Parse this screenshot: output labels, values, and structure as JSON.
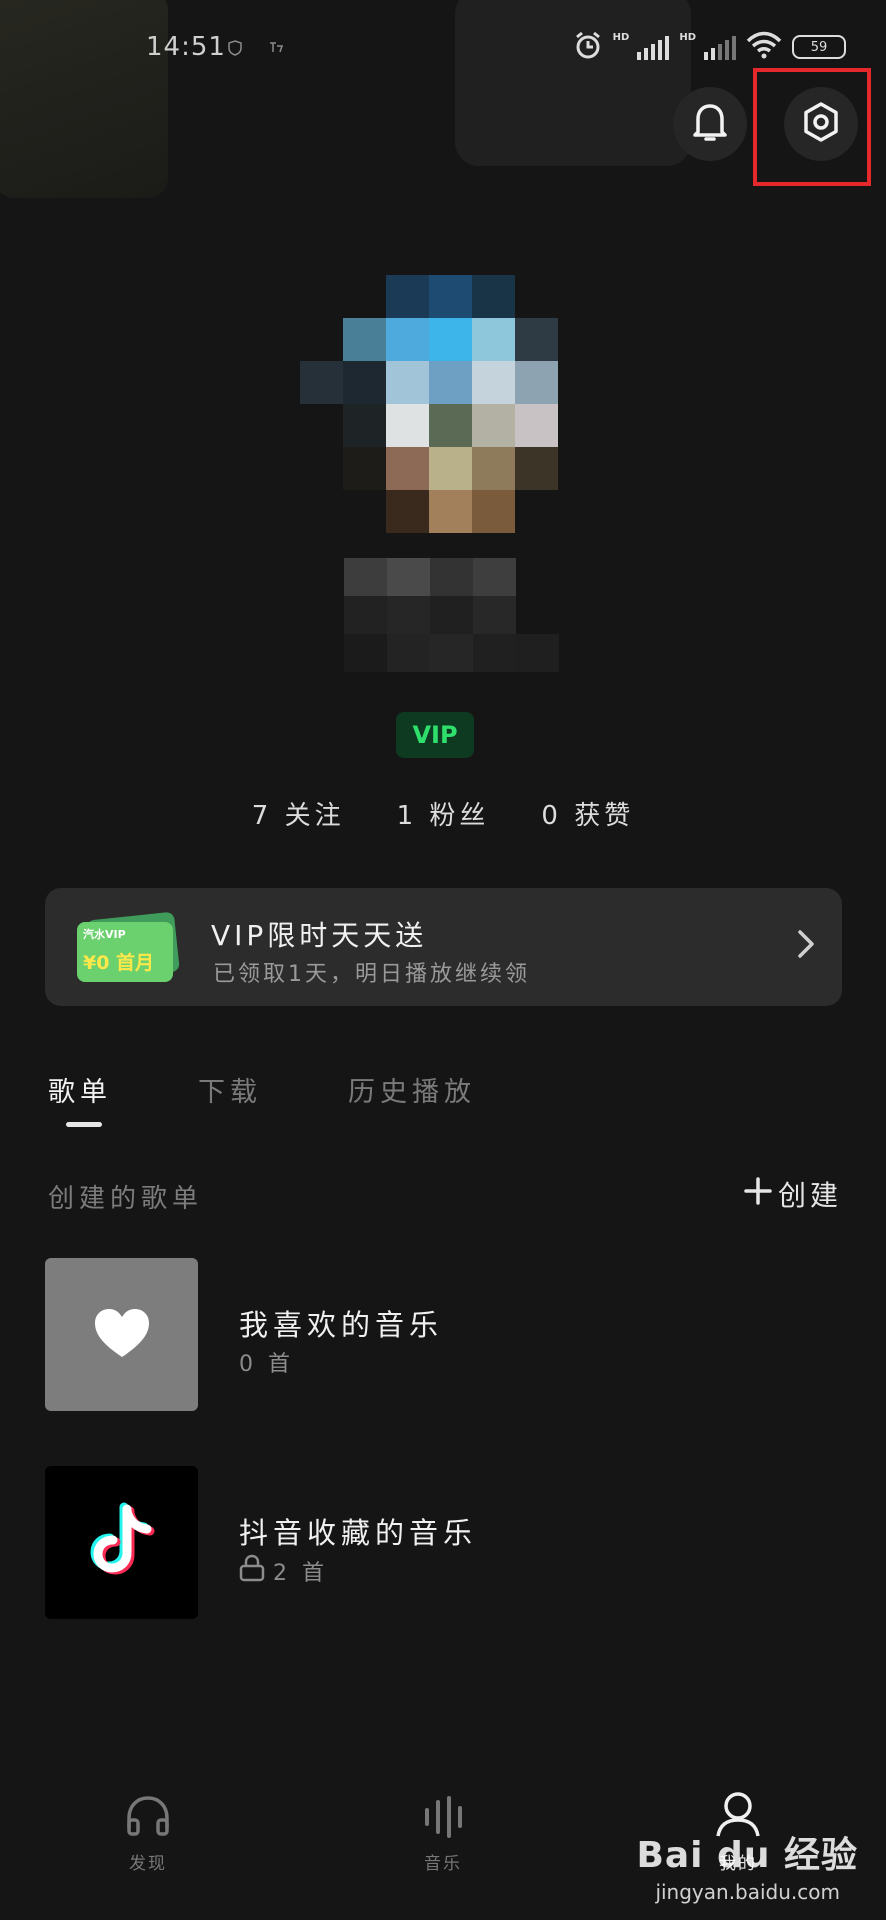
{
  "status_bar": {
    "time": "14:51",
    "battery": "59",
    "hd1": "HD",
    "hd2": "HD"
  },
  "profile": {
    "vip_badge": "VIP"
  },
  "stats": [
    {
      "label": "7 关注"
    },
    {
      "label": "1 粉丝"
    },
    {
      "label": "0 获赞"
    }
  ],
  "promo": {
    "ticket_brand": "汽水VIP",
    "ticket_offer": "¥0 首月",
    "title": "VIP限时天天送",
    "subtitle": "已领取1天，明日播放继续领"
  },
  "tabs": [
    {
      "label": "歌单",
      "active": true
    },
    {
      "label": "下载",
      "active": false
    },
    {
      "label": "历史播放",
      "active": false
    }
  ],
  "section": {
    "title": "创建的歌单",
    "create_label": "创建"
  },
  "playlists": [
    {
      "title": "我喜欢的音乐",
      "count": "0 首"
    },
    {
      "title": "抖音收藏的音乐",
      "count": "2 首"
    }
  ],
  "bottom_nav": [
    {
      "label": "发现"
    },
    {
      "label": "音乐"
    },
    {
      "label": "我的"
    }
  ],
  "watermark": {
    "logo": "Bai du 经验",
    "url": "jingyan.baidu.com"
  },
  "colors": {
    "accent_vip": "#2ee06b",
    "highlight": "#e5282c",
    "background": "#151515"
  }
}
